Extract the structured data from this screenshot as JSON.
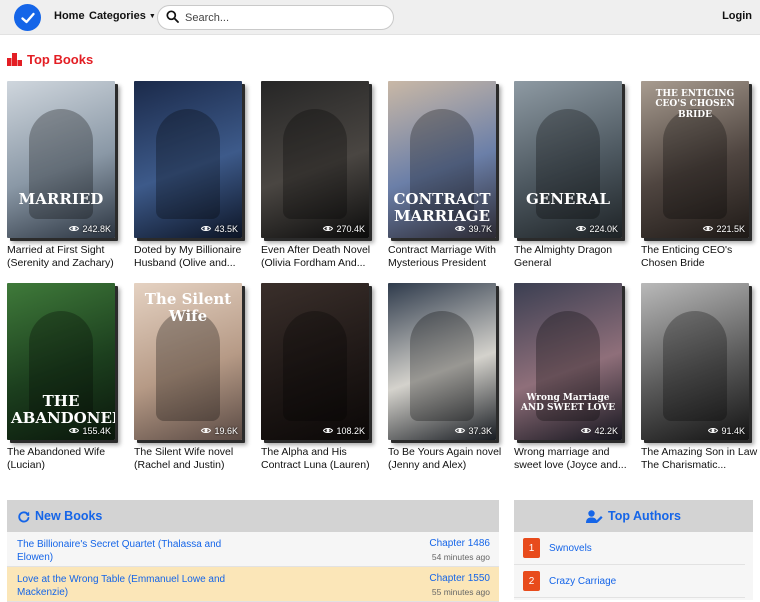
{
  "header": {
    "home_label": "Home",
    "categories_label": "Categories",
    "search_placeholder": "Search...",
    "login_label": "Login",
    "logo_icon": "check-circle-icon",
    "brand_color": "#1565e8"
  },
  "top_books": {
    "title": "Top Books",
    "title_color": "#e31e24",
    "books": [
      {
        "title": "Married at First Sight (Serenity and Zachary)",
        "views": "242.8K",
        "cover_text": "MARRIED",
        "colors": [
          "#cfd6dd",
          "#8a98a6",
          "#2b3440"
        ]
      },
      {
        "title": "Doted by My Billionaire Husband (Olive and...",
        "views": "43.5K",
        "cover_text": "",
        "colors": [
          "#1b2a4a",
          "#3d5a8a",
          "#0d1526"
        ]
      },
      {
        "title": "Even After Death Novel (Olivia Fordham And...",
        "views": "270.4K",
        "cover_text": "",
        "colors": [
          "#262626",
          "#4a4642",
          "#0c0c0c"
        ]
      },
      {
        "title": "Contract Marriage With Mysterious President",
        "views": "39.7K",
        "cover_text": "CONTRACT MARRIAGE",
        "colors": [
          "#c9b8a6",
          "#6b7fa8",
          "#2c2a33"
        ]
      },
      {
        "title": "The Almighty Dragon General",
        "views": "224.0K",
        "cover_text": "GENERAL",
        "colors": [
          "#8e9aa3",
          "#4d5860",
          "#1e2326"
        ]
      },
      {
        "title": "The Enticing CEO's Chosen Bride",
        "views": "221.5K",
        "cover_text": "THE ENTICING CEO'S CHOSEN BRIDE",
        "colors": [
          "#a89c90",
          "#4f4540",
          "#1f1a17"
        ]
      },
      {
        "title": "The Abandoned Wife (Lucian)",
        "views": "155.4K",
        "cover_text": "THE ABANDONED",
        "colors": [
          "#3f7a3a",
          "#1c3f1e",
          "#0a160b"
        ]
      },
      {
        "title": "The Silent Wife novel (Rachel and Justin)",
        "views": "19.6K",
        "cover_text": "The Silent Wife",
        "colors": [
          "#e5d2c2",
          "#b69a86",
          "#5a4a44"
        ]
      },
      {
        "title": "The Alpha and His Contract Luna (Lauren)",
        "views": "108.2K",
        "cover_text": "",
        "colors": [
          "#3a2f2b",
          "#1f1816",
          "#0b0807"
        ]
      },
      {
        "title": "To Be Yours Again novel (Jenny and Alex)",
        "views": "37.3K",
        "cover_text": "",
        "colors": [
          "#2f3b4c",
          "#d4d2cc",
          "#181c22"
        ]
      },
      {
        "title": "Wrong marriage and sweet love (Joyce and...",
        "views": "42.2K",
        "cover_text": "Wrong Marriage AND SWEET LOVE",
        "colors": [
          "#3b3f52",
          "#8f6f7a",
          "#16161f"
        ]
      },
      {
        "title": "The Amazing Son in Law The Charismatic...",
        "views": "91.4K",
        "cover_text": "",
        "colors": [
          "#b9b9b9",
          "#5a5a5a",
          "#141414"
        ]
      }
    ]
  },
  "new_books": {
    "title": "New Books",
    "items": [
      {
        "title": "The Billionaire's Secret Quartet (Thalassa and Elowen)",
        "chapter": "Chapter 1486",
        "ago": "54 minutes ago"
      },
      {
        "title": "Love at the Wrong Table (Emmanuel Lowe and Mackenzie)",
        "chapter": "Chapter 1550",
        "ago": "55 minutes ago"
      }
    ]
  },
  "top_authors": {
    "title": "Top Authors",
    "items": [
      {
        "rank": "1",
        "name": "Swnovels"
      },
      {
        "rank": "2",
        "name": "Crazy Carriage"
      }
    ]
  }
}
